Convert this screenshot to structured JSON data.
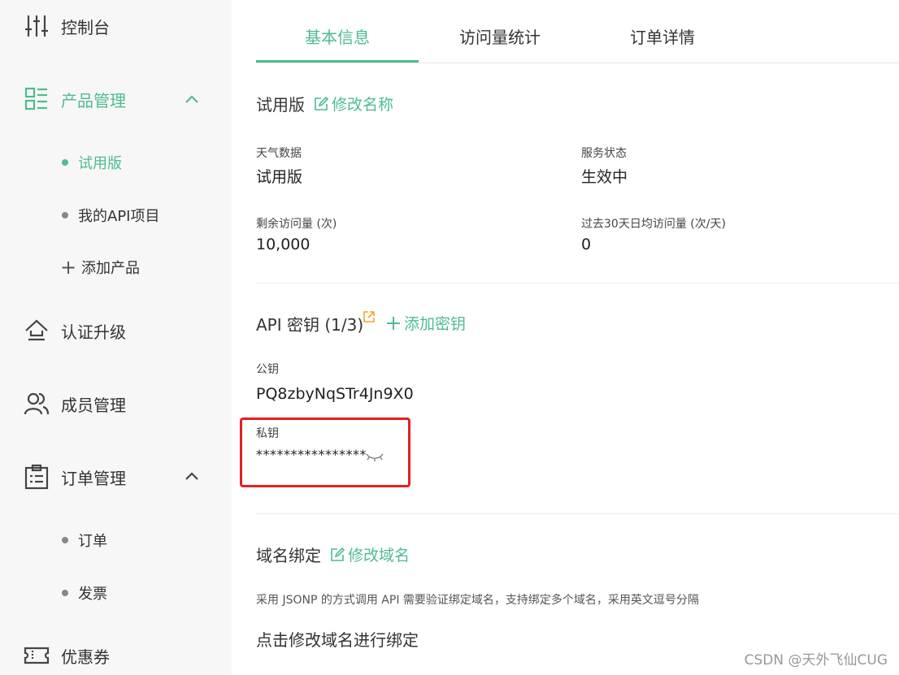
{
  "sidebar": {
    "items": [
      {
        "label": "控制台",
        "icon": "sliders-icon"
      },
      {
        "label": "产品管理",
        "icon": "grid-list-icon"
      },
      {
        "label": "认证升级",
        "icon": "upgrade-icon"
      },
      {
        "label": "成员管理",
        "icon": "users-icon"
      },
      {
        "label": "订单管理",
        "icon": "clipboard-icon"
      },
      {
        "label": "优惠券",
        "icon": "ticket-icon"
      }
    ],
    "product_sub": [
      {
        "label": "试用版"
      },
      {
        "label": "我的API项目"
      },
      {
        "label": "添加产品"
      }
    ],
    "order_sub": [
      {
        "label": "订单"
      },
      {
        "label": "发票"
      }
    ]
  },
  "tabs": [
    {
      "label": "基本信息"
    },
    {
      "label": "访问量统计"
    },
    {
      "label": "订单详情"
    }
  ],
  "product": {
    "name": "试用版",
    "rename_link": "修改名称",
    "fields": [
      {
        "label": "天气数据",
        "value": "试用版"
      },
      {
        "label": "服务状态",
        "value": "生效中"
      },
      {
        "label": "剩余访问量 (次)",
        "value": "10,000"
      },
      {
        "label": "过去30天日均访问量 (次/天)",
        "value": "0"
      }
    ]
  },
  "api_keys": {
    "title": "API 密钥 (1/3)",
    "add_link": "添加密钥",
    "public_label": "公钥",
    "public_value": "PQ8zbyNqSTr4Jn9X0",
    "private_label": "私钥",
    "private_value": "****************"
  },
  "domain": {
    "title": "域名绑定",
    "edit_link": "修改域名",
    "description": "采用 JSONP 的方式调用 API 需要验证绑定域名，支持绑定多个域名，采用英文逗号分隔",
    "prompt": "点击修改域名进行绑定"
  },
  "watermark": "CSDN @天外飞仙CUG",
  "colors": {
    "accent": "#4ebc8f",
    "highlight_box": "#e5201d",
    "link_orange": "#f5a623"
  }
}
